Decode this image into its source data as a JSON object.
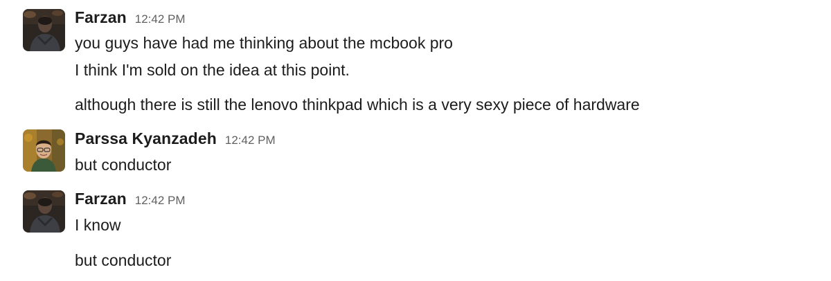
{
  "messages": [
    {
      "author": "Farzan",
      "time": "12:42 PM",
      "lines": [
        "you guys have had me thinking about the mcbook pro",
        "I think I'm sold on the idea at this point.",
        "although there is still the lenovo thinkpad which is a very sexy piece of hardware"
      ]
    },
    {
      "author": "Parssa Kyanzadeh",
      "time": "12:42 PM",
      "lines": [
        "but conductor"
      ]
    },
    {
      "author": "Farzan",
      "time": "12:42 PM",
      "lines": [
        "I know",
        "but conductor"
      ]
    }
  ],
  "colors": {
    "text": "#1d1c1d",
    "timestamp": "#616061",
    "background": "#ffffff"
  }
}
